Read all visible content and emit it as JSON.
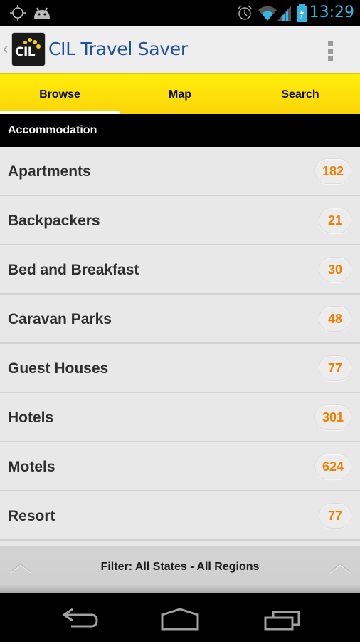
{
  "status_bar": {
    "time": "13:29",
    "icons": [
      "gps-icon",
      "android-debug-icon",
      "alarm-icon",
      "wifi-icon",
      "signal-icon",
      "battery-charging-icon"
    ]
  },
  "action_bar": {
    "title": "CIL Travel Saver",
    "logo_text": "CIL",
    "up_caret": "‹",
    "overflow_icon": "overflow-menu-icon"
  },
  "tabs": [
    {
      "label": "Browse",
      "active": true
    },
    {
      "label": "Map",
      "active": false
    },
    {
      "label": "Search",
      "active": false
    }
  ],
  "section": {
    "title": "Accommodation"
  },
  "list": {
    "items": [
      {
        "label": "Apartments",
        "count": "182"
      },
      {
        "label": "Backpackers",
        "count": "21"
      },
      {
        "label": "Bed and Breakfast",
        "count": "30"
      },
      {
        "label": "Caravan Parks",
        "count": "48"
      },
      {
        "label": "Guest Houses",
        "count": "77"
      },
      {
        "label": "Hotels",
        "count": "301"
      },
      {
        "label": "Motels",
        "count": "624"
      },
      {
        "label": "Resort",
        "count": "77"
      }
    ]
  },
  "filter_bar": {
    "text": "Filter: All States - All Regions"
  },
  "colors": {
    "accent_yellow": "#fde40a",
    "title_blue": "#1e4fa0",
    "count_orange": "#f07f00",
    "status_blue": "#33b5e5"
  }
}
